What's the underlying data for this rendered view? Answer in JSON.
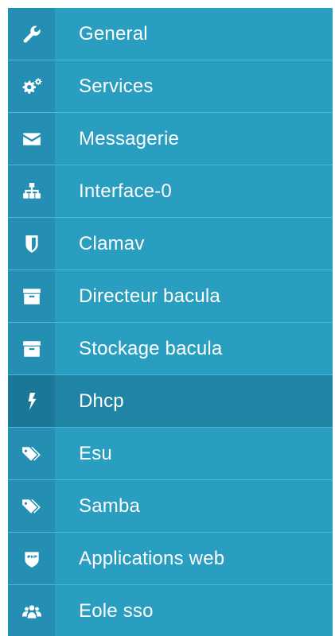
{
  "sidebar": {
    "items": [
      {
        "label": "General",
        "icon": "wrench-icon"
      },
      {
        "label": "Services",
        "icon": "gears-icon"
      },
      {
        "label": "Messagerie",
        "icon": "envelope-icon"
      },
      {
        "label": "Interface-0",
        "icon": "sitemap-icon"
      },
      {
        "label": "Clamav",
        "icon": "shield-icon"
      },
      {
        "label": "Directeur bacula",
        "icon": "archive-icon"
      },
      {
        "label": "Stockage bacula",
        "icon": "archive-icon"
      },
      {
        "label": "Dhcp",
        "icon": "bolt-icon",
        "active": true
      },
      {
        "label": "Esu",
        "icon": "tags-icon"
      },
      {
        "label": "Samba",
        "icon": "tags-icon"
      },
      {
        "label": "Applications web",
        "icon": "php-icon"
      },
      {
        "label": "Eole sso",
        "icon": "users-icon"
      }
    ]
  },
  "colors": {
    "sidebar_bg": "#2a9ec1",
    "icon_cell_bg": "#248fb3",
    "active_bg": "#1f84a5",
    "text": "#ffffff"
  }
}
